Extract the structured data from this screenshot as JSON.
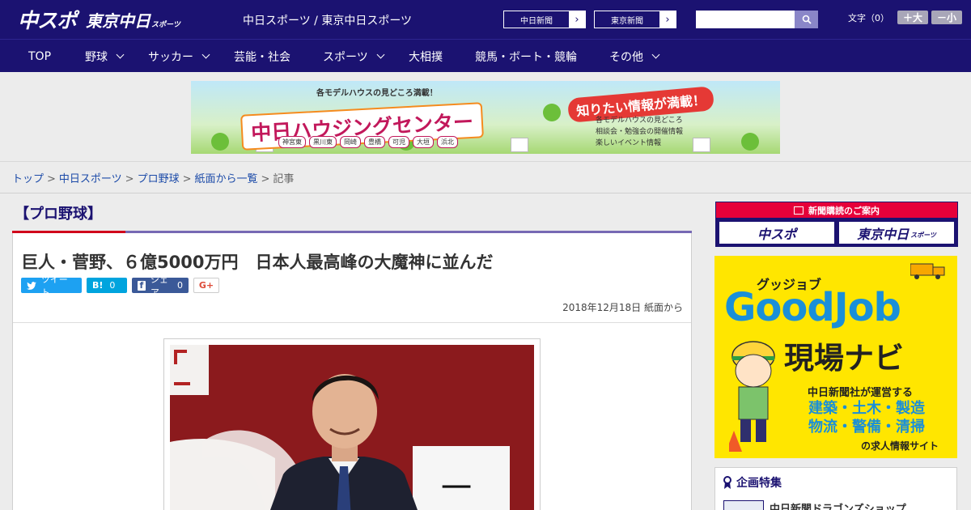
{
  "header": {
    "logo_primary": "中スポ",
    "logo_secondary": "東京中日",
    "logo_secondary_suffix": "スポーツ",
    "site_title": "中日スポーツ / 東京中日スポーツ",
    "link_chunichi": "中日新聞",
    "link_tokyo": "東京新聞",
    "search_placeholder": "",
    "font_label": "文字（0）",
    "font_bigger": "＋大",
    "font_smaller": "－小"
  },
  "nav": {
    "items": [
      {
        "label": "TOP",
        "dropdown": false
      },
      {
        "label": "野球",
        "dropdown": true
      },
      {
        "label": "サッカー",
        "dropdown": true
      },
      {
        "label": "芸能・社会",
        "dropdown": false
      },
      {
        "label": "スポーツ",
        "dropdown": true
      },
      {
        "label": "大相撲",
        "dropdown": false
      },
      {
        "label": "競馬・ボート・競輪",
        "dropdown": false
      },
      {
        "label": "その他",
        "dropdown": true
      }
    ]
  },
  "banner": {
    "tagline": "各モデルハウスの見どころ満載！",
    "title": "中日ハウジングセンター",
    "callout": "知りたい情報が満載！",
    "towns": [
      "神宮東",
      "黒川東",
      "岡崎",
      "豊橋",
      "可児",
      "大垣",
      "浜北"
    ],
    "features": [
      "各モデルハウスの見どころ",
      "相談会・勉強会の開催情報",
      "楽しいイベント情報"
    ]
  },
  "breadcrumb": {
    "items": [
      "トップ",
      "中日スポーツ",
      "プロ野球",
      "紙面から一覧"
    ],
    "current": "記事"
  },
  "article": {
    "category": "【プロ野球】",
    "headline": "巨人・菅野、６億5000万円　日本人最高峰の大魔神に並んだ",
    "share": {
      "tweet": "ツイート",
      "hatena": "B!",
      "hatena_count": "0",
      "facebook": "シェア",
      "facebook_count": "0",
      "gplus": "G+"
    },
    "date": "2018年12月18日 紙面から"
  },
  "sidebar": {
    "subscribe_title": "新聞購読のご案内",
    "subscribe_chuspo": "中スポ",
    "subscribe_tokyo": "東京中日",
    "subscribe_tokyo_suffix": "スポーツ",
    "goodjob_kana": "グッジョブ",
    "goodjob_title": "GoodJob",
    "goodjob_sub": "現場ナビ",
    "goodjob_line1": "中日新聞社が運営する",
    "goodjob_line2": "建築・土木・製造",
    "goodjob_line3": "物流・警備・清掃",
    "goodjob_line4": "の求人情報サイト",
    "feature_title": "企画特集",
    "feature_item": "中日新聞ドラゴンズショップ"
  },
  "colors": {
    "brand_navy": "#1b1271",
    "accent_red": "#d0021b",
    "accent_purple": "#7669b4"
  }
}
